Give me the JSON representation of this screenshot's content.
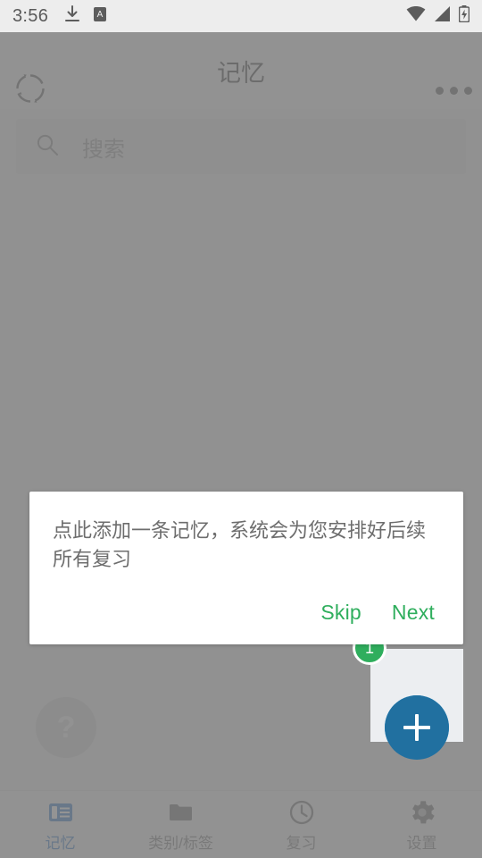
{
  "status_bar": {
    "time": "3:56",
    "icons_left": [
      "download-icon",
      "keyboard-input-a-icon"
    ],
    "icons_right": [
      "wifi-icon",
      "cellular-signal-icon",
      "battery-charging-icon"
    ]
  },
  "app_bar": {
    "title": "记忆",
    "sync_icon": "sync-refresh-icon",
    "overflow_icon": "overflow-menu-icon"
  },
  "search": {
    "placeholder": "搜索",
    "icon": "search-icon"
  },
  "help": {
    "label": "?",
    "icon": "help-question-icon"
  },
  "fab": {
    "icon": "plus-icon",
    "color": "#2aabef",
    "dim_color": "#2170a0"
  },
  "spotlight_badge": {
    "count": "1",
    "color": "#2fae5d"
  },
  "tooltip": {
    "message": "点此添加一条记忆，系统会为您安排好后续所有复习",
    "skip_label": "Skip",
    "next_label": "Next",
    "accent_color": "#2fae5d"
  },
  "bottom_nav": {
    "active_color": "#1565c0",
    "inactive_color": "#6b6b6b",
    "items": [
      {
        "label": "记忆",
        "icon": "reader-mode-icon",
        "active": true
      },
      {
        "label": "类别/标签",
        "icon": "folder-icon",
        "active": false
      },
      {
        "label": "复习",
        "icon": "clock-icon",
        "active": false
      },
      {
        "label": "设置",
        "icon": "gear-icon",
        "active": false
      }
    ]
  }
}
